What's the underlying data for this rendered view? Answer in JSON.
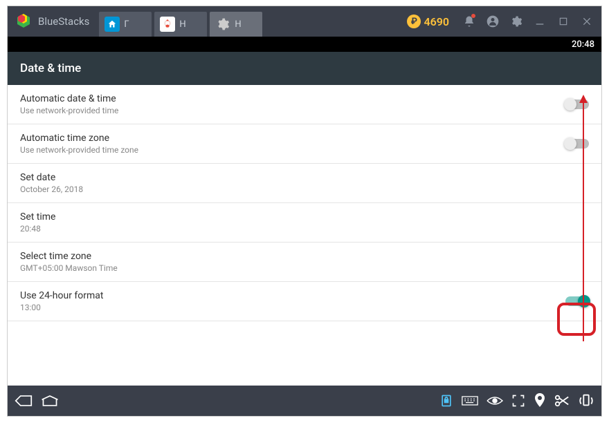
{
  "titlebar": {
    "title": "BlueStacks",
    "tabs": [
      {
        "label": "Г"
      },
      {
        "label": "Н"
      },
      {
        "label": "Н"
      }
    ],
    "points": "4690"
  },
  "statusbar": {
    "time": "20:48"
  },
  "header": {
    "title": "Date & time"
  },
  "settings": [
    {
      "title": "Automatic date & time",
      "subtitle": "Use network-provided time",
      "switch": "off"
    },
    {
      "title": "Automatic time zone",
      "subtitle": "Use network-provided time zone",
      "switch": "off"
    },
    {
      "title": "Set date",
      "subtitle": "October 26, 2018"
    },
    {
      "title": "Set time",
      "subtitle": "20:48"
    },
    {
      "title": "Select time zone",
      "subtitle": "GMT+05:00 Mawson Time"
    },
    {
      "title": "Use 24-hour format",
      "subtitle": "13:00",
      "switch": "on"
    }
  ]
}
